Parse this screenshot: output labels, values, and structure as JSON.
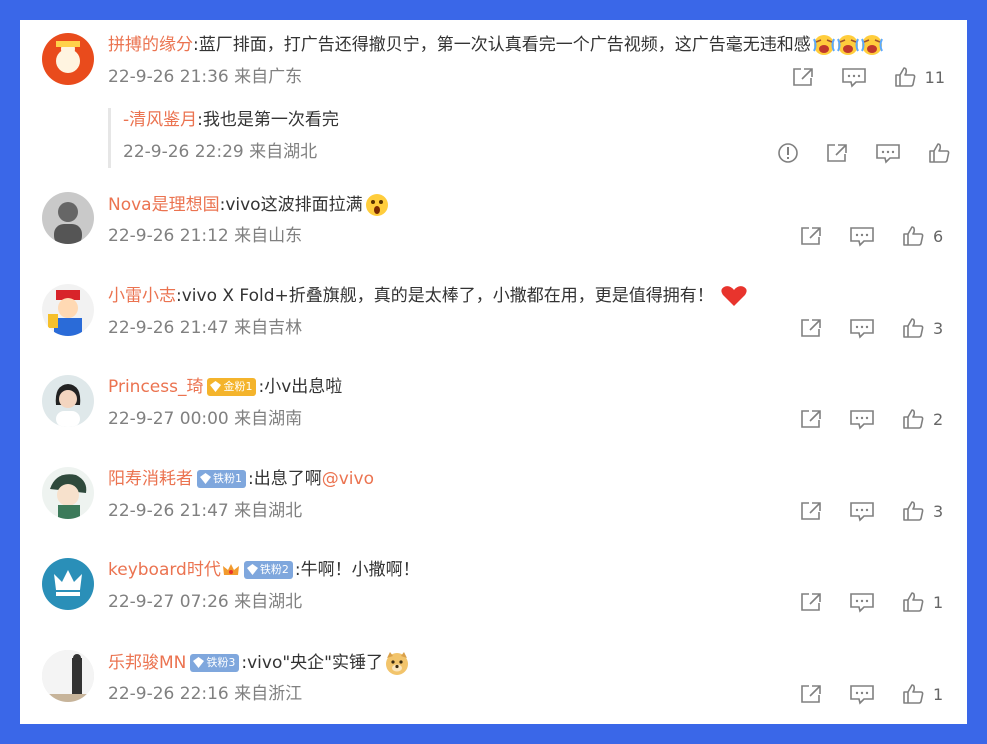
{
  "colors": {
    "background": "#3a67e8",
    "username": "#eb7350",
    "meta": "#808080",
    "text": "#333333"
  },
  "comments": [
    {
      "user": "拼搏的缘分",
      "text": ":蓝厂排面，打广告还得撤贝宁，第一次认真看完一个广告视频，这广告毫无违和感",
      "emoji": "crying-laugh-emoji x3",
      "date": "22-9-26 21:36",
      "location": "来自广东",
      "likes": "11",
      "reply": {
        "user": "-清风鉴月",
        "text": ":我也是第一次看完",
        "date": "22-9-26 22:29",
        "location": "来自湖北"
      }
    },
    {
      "user": "Nova是理想国",
      "text": ":vivo这波排面拉满",
      "emoji": "shocked-emoji",
      "date": "22-9-26 21:12",
      "location": "来自山东",
      "likes": "6"
    },
    {
      "user": "小雷小志",
      "text": ":vivo X Fold+折叠旗舰，真的是太棒了，小撒都在用，更是值得拥有！",
      "emoji": "heart-emoji",
      "date": "22-9-26 21:47",
      "location": "来自吉林",
      "likes": "3"
    },
    {
      "user": "Princess_琦",
      "badge": "金粉1",
      "text": ":小v出息啦",
      "date": "22-9-27 00:00",
      "location": "来自湖南",
      "likes": "2"
    },
    {
      "user": "阳寿消耗者",
      "badge": "铁粉1",
      "text": ":出息了啊",
      "mention": "@vivo",
      "date": "22-9-26 21:47",
      "location": "来自湖北",
      "likes": "3"
    },
    {
      "user": "keyboard时代",
      "badge": "铁粉2",
      "text": ":牛啊！小撒啊！",
      "date": "22-9-27 07:26",
      "location": "来自湖北",
      "likes": "1"
    },
    {
      "user": "乐邦骏MN",
      "badge": "铁粉3",
      "text": ":vivo\"央企\"实锤了",
      "emoji": "doge-emoji",
      "date": "22-9-26 22:16",
      "location": "来自浙江",
      "likes": "1"
    }
  ],
  "icons": [
    "share-icon",
    "comment-icon",
    "like-icon",
    "report-icon"
  ]
}
